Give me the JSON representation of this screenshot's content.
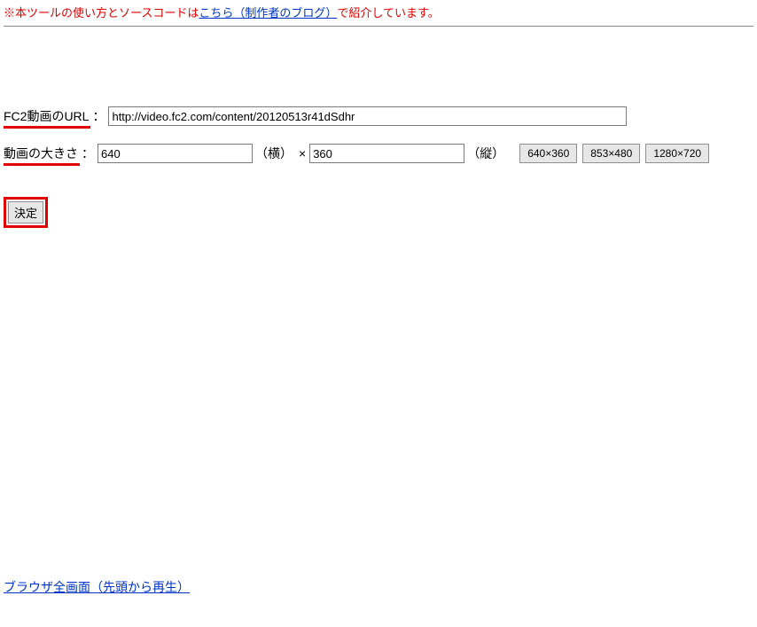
{
  "note": {
    "prefix": "※本ツールの使い方とソースコードは",
    "link": "こちら（制作者のブログ）",
    "suffix": "で紹介しています。"
  },
  "url_row": {
    "label": "FC2動画のURL",
    "colon": "：",
    "value": "http://video.fc2.com/content/20120513r41dSdhr"
  },
  "size_row": {
    "label": "動画の大きさ",
    "colon": "：",
    "width": "640",
    "width_label": "（横）",
    "x": "×",
    "height": "360",
    "height_label": "（縦）",
    "presets": [
      "640×360",
      "853×480",
      "1280×720"
    ]
  },
  "submit_label": "決定",
  "bottom_link": "ブラウザ全画面（先頭から再生）"
}
